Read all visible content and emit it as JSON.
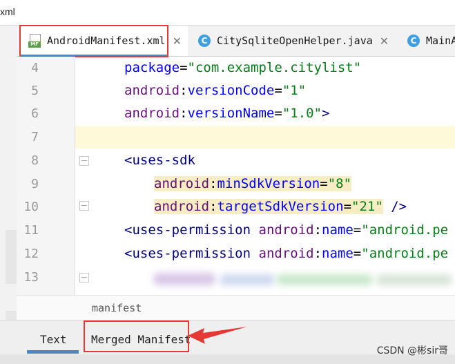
{
  "window": {
    "title_fragment": "xml"
  },
  "tabs": [
    {
      "label": "AndroidManifest.xml",
      "icon": "manifest-file-icon",
      "icon_text": "MF",
      "active": true
    },
    {
      "label": "CitySqliteOpenHelper.java",
      "icon": "java-class-icon",
      "icon_text": "C",
      "active": false
    },
    {
      "label": "MainA",
      "icon": "java-class-icon",
      "icon_text": "C",
      "active": false
    }
  ],
  "editor": {
    "line_numbers": [
      "4",
      "5",
      "6",
      "7",
      "8",
      "9",
      "10",
      "11",
      "12",
      "13"
    ],
    "lines": {
      "l4": {
        "attr": "package",
        "eq": "=",
        "val": "\"com.example.citylist\""
      },
      "l5": {
        "ns": "android",
        "colon": ":",
        "attr": "versionCode",
        "eq": "=",
        "val": "\"1\""
      },
      "l6": {
        "ns": "android",
        "colon": ":",
        "attr": "versionName",
        "eq": "=",
        "val": "\"1.0\"",
        "close": ">"
      },
      "l8": {
        "open": "<",
        "tag": "uses-sdk"
      },
      "l9": {
        "ns": "android",
        "colon": ":",
        "attr": "minSdkVersion",
        "eq": "=",
        "val": "\"8\""
      },
      "l10": {
        "ns": "android",
        "colon": ":",
        "attr": "targetSdkVersion",
        "eq": "=",
        "val": "\"21\"",
        "close": " />"
      },
      "l11": {
        "open": "<",
        "tag": "uses-permission",
        "sp": " ",
        "ns": "android",
        "colon": ":",
        "attr": "name",
        "eq": "=",
        "val": "\"android.pe"
      },
      "l12": {
        "open": "<",
        "tag": "uses-permission",
        "sp": " ",
        "ns": "android",
        "colon": ":",
        "attr": "name",
        "eq": "=",
        "val": "\"android.pe"
      }
    }
  },
  "breadcrumb": {
    "text": "manifest"
  },
  "bottom_tabs": {
    "text": "Text",
    "merged": "Merged Manifest"
  },
  "watermark": {
    "text": "CSDN @彬sir哥"
  },
  "colors": {
    "annotation_red": "#e53935",
    "tab_accent": "#4a88c7",
    "string_green": "#067d17",
    "attr_blue": "#0000ff",
    "tag_navy": "#000080",
    "namespace_purple": "#660e7a"
  }
}
